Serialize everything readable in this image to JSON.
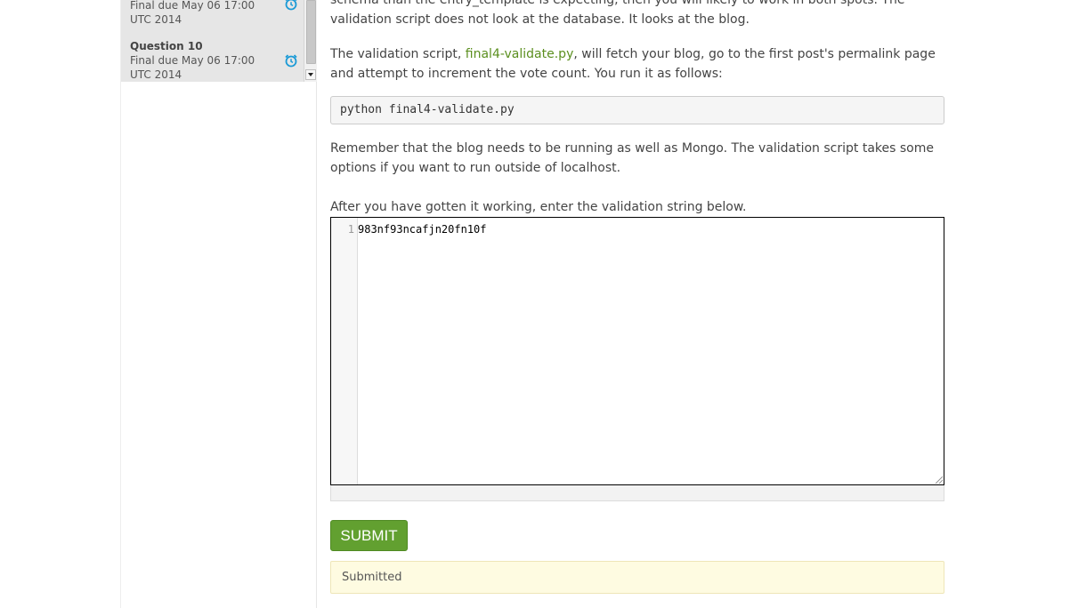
{
  "sidebar": {
    "items": [
      {
        "title": "",
        "due": "Final due May 06 17:00",
        "tz": "UTC 2014"
      },
      {
        "title": "Question 10",
        "due": "Final due May 06 17:00",
        "tz": "UTC 2014"
      }
    ],
    "icon": "alarm-clock-icon",
    "icon_color": "#1a9ad6"
  },
  "content": {
    "para_top": "schema than the entry_template is expecting, then you will likely to work in both spots. The",
    "para_top2": "validation script does not look at the database. It looks at the blog.",
    "para2_pre": "The validation script, ",
    "para2_link": "final4-validate.py",
    "para2_post": ", will fetch your blog, go to the first post's permalink page",
    "para2_line2": "and attempt to increment the vote count. You run it as follows:",
    "code": "python final4-validate.py",
    "para3_line1": "Remember that the blog needs to be running as well as Mongo. The validation script takes some",
    "para3_line2": "options if you want to run outside of localhost.",
    "para4": "After you have gotten it working, enter the validation string below."
  },
  "editor": {
    "line_number": "1",
    "value": "983nf93ncafjn20fn10f"
  },
  "actions": {
    "submit_label": "SUBMIT",
    "status_text": "Submitted"
  },
  "colors": {
    "accent": "#62a030",
    "link": "#5b8f1f",
    "notice_bg": "#fefbe1"
  }
}
